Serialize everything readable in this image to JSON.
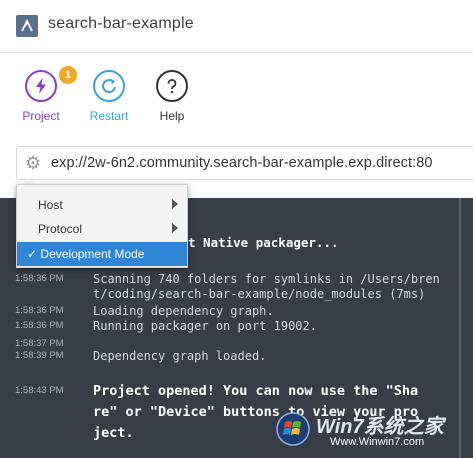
{
  "window": {
    "title": "search-bar-example",
    "logo_icon": "expo-logo-icon"
  },
  "toolbar": {
    "project": {
      "label": "Project",
      "badge": "1",
      "icon": "lightning-icon",
      "color": "#8a3cc9",
      "badge_color": "#f5a623"
    },
    "restart": {
      "label": "Restart",
      "icon": "refresh-icon",
      "color": "#3aa3dd"
    },
    "help": {
      "label": "Help",
      "icon": "question-icon",
      "color": "#333333"
    }
  },
  "urlbar": {
    "icon": "gear-icon",
    "url": "exp://2w-6n2.community.search-bar-example.exp.direct:80"
  },
  "menu": {
    "items": [
      {
        "label": "Host",
        "has_submenu": true
      },
      {
        "label": "Protocol",
        "has_submenu": true
      },
      {
        "label": "Development Mode",
        "checked": true,
        "check_mark": "✓"
      }
    ],
    "selected_color": "#2f86d6"
  },
  "console": {
    "background": "#383d48",
    "header_fragment": "t Native packager...",
    "logs": [
      {
        "time": "1:58:36 PM",
        "lines": [
          "Scanning 740 folders for symlinks in /Users/bren",
          "t/coding/search-bar-example/node_modules (7ms)"
        ]
      },
      {
        "time": "1:58:36 PM",
        "lines": [
          "Loading dependency graph."
        ]
      },
      {
        "time": "1:58:36 PM",
        "lines": [
          "Running packager on port 19002."
        ]
      },
      {
        "time": "1:58:37 PM",
        "lines": [
          ""
        ]
      },
      {
        "time": "1:58:39 PM",
        "lines": [
          "Dependency graph loaded."
        ]
      },
      {
        "time": "1:58:43 PM",
        "lines": [
          "Project opened! You can now use the \"Sha",
          "re\" or \"Device\" buttons to view your pro",
          "ject."
        ]
      }
    ]
  },
  "watermark": {
    "brand": "Win7系统之家",
    "url": "Www.Winwin7.com"
  }
}
